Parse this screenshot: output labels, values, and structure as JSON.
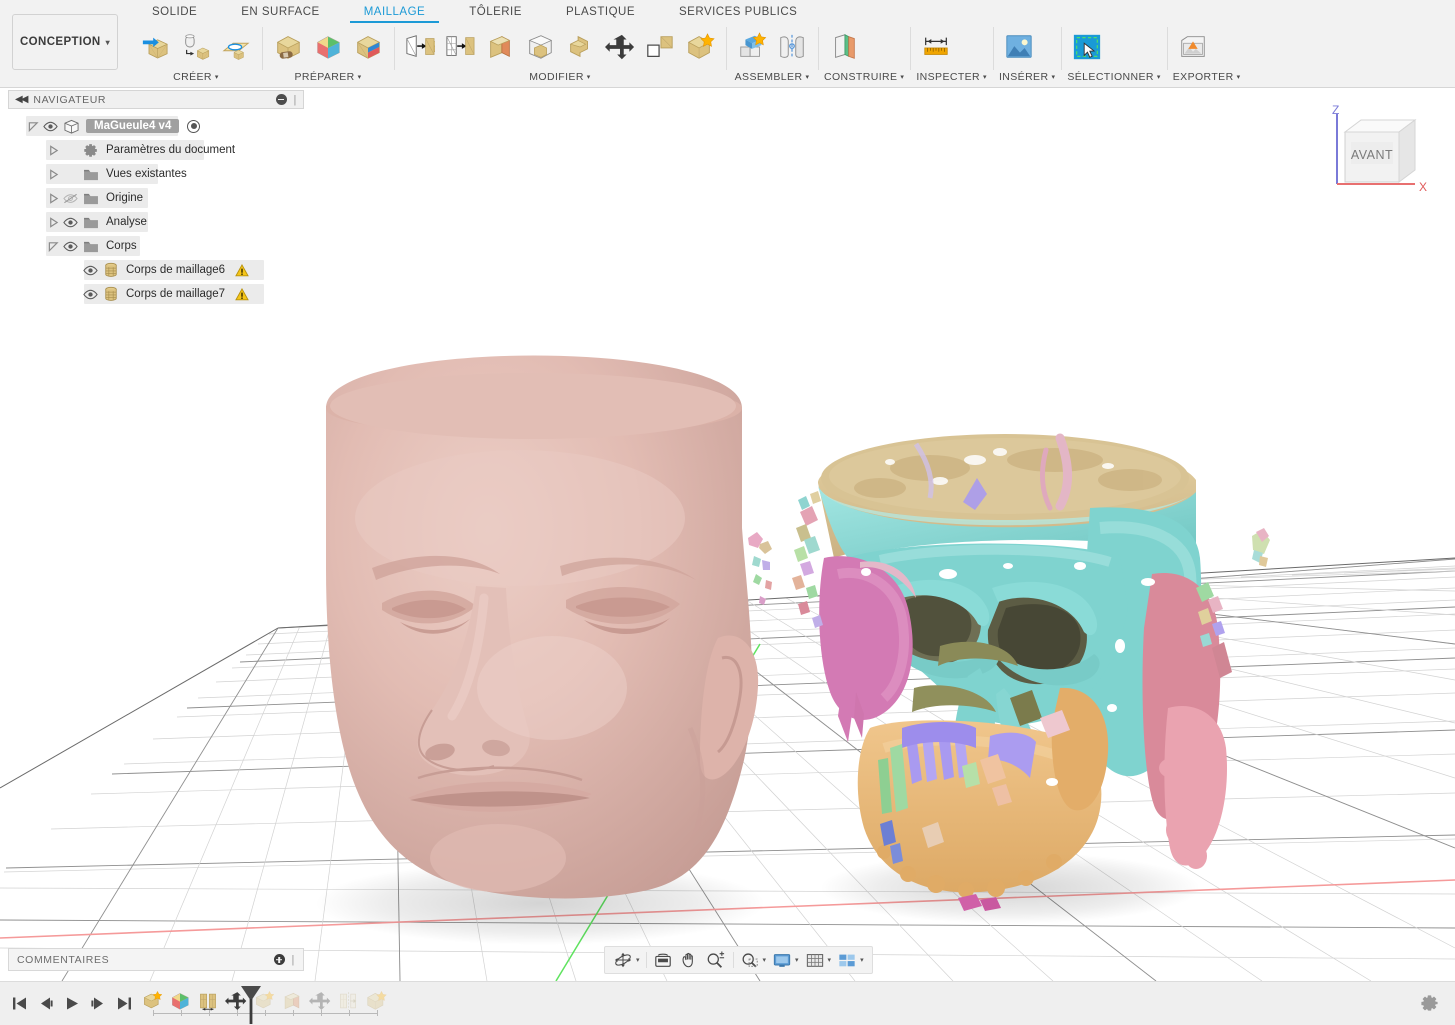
{
  "app": {
    "workspace": "CONCEPTION",
    "workspace_caret": "▾"
  },
  "ribbon": {
    "tabs": [
      {
        "label": "SOLIDE",
        "active": false
      },
      {
        "label": "EN SURFACE",
        "active": false
      },
      {
        "label": "MAILLAGE",
        "active": true
      },
      {
        "label": "TÔLERIE",
        "active": false
      },
      {
        "label": "PLASTIQUE",
        "active": false
      },
      {
        "label": "SERVICES PUBLICS",
        "active": false
      }
    ],
    "panels": [
      {
        "label": "CRÉER",
        "caret": "▾",
        "tools": [
          "mesh-create-icon",
          "mesh-convert-icon",
          "mesh-plane-icon"
        ]
      },
      {
        "label": "PRÉPARER",
        "caret": "▾",
        "tools": [
          "mesh-repair-icon",
          "mesh-segment-icon",
          "mesh-remesh-icon"
        ]
      },
      {
        "label": "MODIFIER",
        "caret": "▾",
        "tools": [
          "mesh-reduce-icon",
          "mesh-refine-icon",
          "mesh-plane-cut-icon",
          "mesh-shell-icon",
          "mesh-combine-icon",
          "mesh-move-icon",
          "mesh-face-group-icon",
          "mesh-merge-icon"
        ]
      },
      {
        "label": "ASSEMBLER",
        "caret": "▾",
        "tools": [
          "assemble-new-component-icon",
          "assemble-joint-icon"
        ]
      },
      {
        "label": "CONSTRUIRE",
        "caret": "▾",
        "tools": [
          "construct-plane-icon"
        ]
      },
      {
        "label": "INSPECTER",
        "caret": "▾",
        "tools": [
          "measure-ruler-icon"
        ]
      },
      {
        "label": "INSÉRER",
        "caret": "▾",
        "tools": [
          "insert-image-icon"
        ]
      },
      {
        "label": "SÉLECTIONNER",
        "caret": "▾",
        "tools": [
          "select-window-icon"
        ]
      },
      {
        "label": "EXPORTER",
        "caret": "▾",
        "tools": [
          "export-mesh-icon"
        ]
      }
    ]
  },
  "navigator": {
    "title": "NAVIGATEUR",
    "collapse_icon": "collapse-left-icon",
    "minimize_icon": "minimize-icon",
    "grip_icon": "grip-handle-icon",
    "tree": [
      {
        "label": "MaGueule4 v4",
        "indent": 0,
        "type": "root",
        "expanded": true,
        "visible": true,
        "bgw": 152
      },
      {
        "label": "Paramètres du document",
        "indent": 1,
        "type": "settings",
        "expanded": false,
        "visible": null,
        "bgw": 158
      },
      {
        "label": "Vues existantes",
        "indent": 1,
        "type": "folder",
        "expanded": false,
        "visible": null,
        "bgw": 112
      },
      {
        "label": "Origine",
        "indent": 1,
        "type": "folder",
        "expanded": false,
        "visible": false,
        "bgw": 102
      },
      {
        "label": "Analyse",
        "indent": 1,
        "type": "folder",
        "expanded": false,
        "visible": true,
        "bgw": 102
      },
      {
        "label": "Corps",
        "indent": 1,
        "type": "folder",
        "expanded": true,
        "visible": true,
        "bgw": 94
      },
      {
        "label": "Corps de maillage6",
        "indent": 2,
        "type": "mesh-body",
        "expanded": null,
        "visible": true,
        "warning": true,
        "bgw": 180
      },
      {
        "label": "Corps de maillage7",
        "indent": 2,
        "type": "mesh-body",
        "expanded": null,
        "visible": true,
        "warning": true,
        "bgw": 180
      }
    ]
  },
  "viewcube": {
    "face_label": "AVANT",
    "axis_z": "Z",
    "axis_x": "X",
    "axis_z_color": "#6a6ad8",
    "axis_x_color": "#e05a5a"
  },
  "viewport": {
    "background": "#ffffff",
    "grid_major_color": "#8c8c8c",
    "grid_minor_color": "#c9c9c9",
    "axis_x_color": "#f08a8a",
    "axis_y_color": "#5ee25e",
    "models": [
      {
        "name": "head-scan-mesh",
        "body": "Corps de maillage6",
        "color": "#dfb4ac",
        "description": "Scanned human head, flat-topped, skin tone mesh"
      },
      {
        "name": "skull-ct-mesh",
        "body": "Corps de maillage7",
        "description": "Segmented CT skull, multi-colored bone regions",
        "palette": [
          "#88d8d4",
          "#dcc490",
          "#d97fb5",
          "#e8b87a",
          "#a99af0",
          "#e4939f",
          "#9fd9a2",
          "#c3a0c8",
          "#d9a3a3"
        ]
      }
    ]
  },
  "navbar": {
    "buttons": [
      {
        "name": "orbit-icon",
        "caret": "▾"
      },
      {
        "name": "display-settings-icon",
        "caret": ""
      },
      {
        "name": "pan-hand-icon",
        "caret": ""
      },
      {
        "name": "zoom-icon",
        "caret": ""
      },
      {
        "name": "fit-zoom-window-icon",
        "caret": "▾"
      },
      {
        "name": "display-mode-icon",
        "caret": "▾"
      },
      {
        "name": "grid-snaps-icon",
        "caret": "▾"
      },
      {
        "name": "viewports-layout-icon",
        "caret": "▾"
      }
    ]
  },
  "comments": {
    "title": "COMMENTAIRES",
    "add_icon": "add-comment-icon",
    "grip_icon": "grip-handle-icon"
  },
  "timeline": {
    "playback": [
      {
        "name": "go-to-beginning-button",
        "glyph": "jump-start-icon"
      },
      {
        "name": "step-back-button",
        "glyph": "step-back-icon"
      },
      {
        "name": "play-button",
        "glyph": "play-icon"
      },
      {
        "name": "step-forward-button",
        "glyph": "step-forward-icon"
      },
      {
        "name": "go-to-end-button",
        "glyph": "jump-end-icon"
      }
    ],
    "features": [
      {
        "name": "feature-mesh-insert",
        "icon": "mesh-insert-icon",
        "dimmed": false
      },
      {
        "name": "feature-mesh-segment",
        "icon": "mesh-segment-icon",
        "dimmed": false
      },
      {
        "name": "feature-mesh-split",
        "icon": "mesh-split-icon",
        "dimmed": false
      },
      {
        "name": "feature-mesh-move",
        "icon": "mesh-move-icon",
        "dimmed": false
      },
      {
        "name": "feature-mesh-insert-2",
        "icon": "mesh-insert-icon",
        "dimmed": true
      },
      {
        "name": "feature-mesh-plane-cut",
        "icon": "mesh-plane-cut-icon",
        "dimmed": true
      },
      {
        "name": "feature-mesh-move-2",
        "icon": "mesh-move-icon",
        "dimmed": true
      },
      {
        "name": "feature-mesh-mirror",
        "icon": "mesh-mirror-icon",
        "dimmed": true
      },
      {
        "name": "feature-mesh-merge",
        "icon": "mesh-merge-icon",
        "dimmed": true
      }
    ],
    "playhead_after_index": 3,
    "settings_icon": "gear-icon"
  }
}
